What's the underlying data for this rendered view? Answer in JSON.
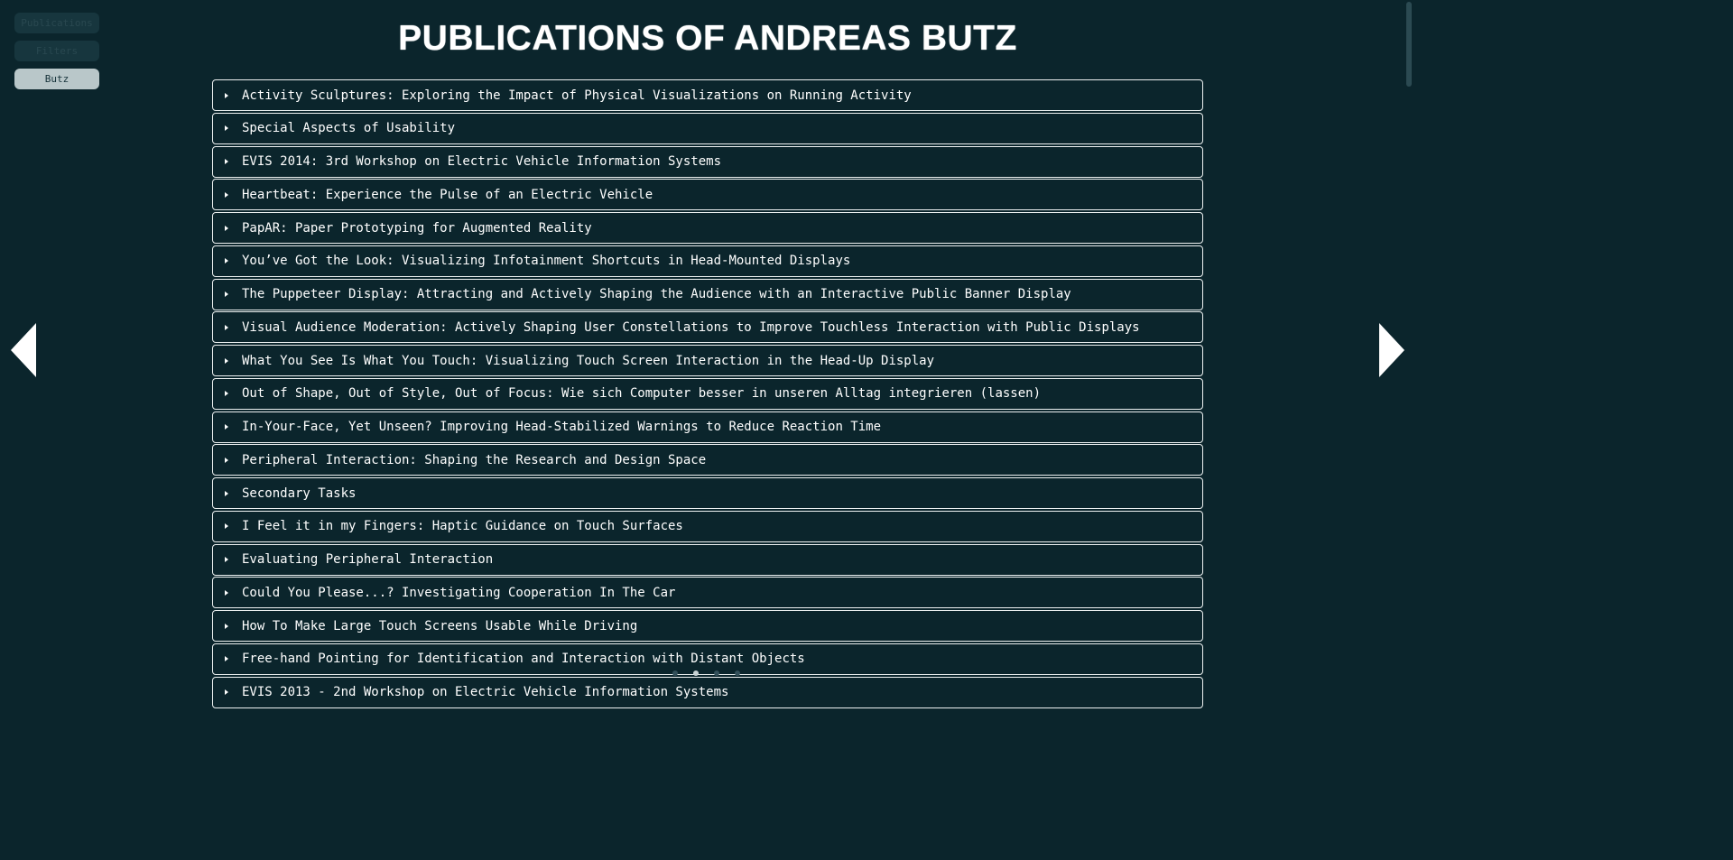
{
  "nav": {
    "buttons": [
      {
        "label": "Publications",
        "state": "muted"
      },
      {
        "label": "Filters",
        "state": "muted"
      },
      {
        "label": "Butz",
        "state": "active"
      }
    ]
  },
  "page": {
    "title": "Publications of Andreas Butz"
  },
  "publications": [
    {
      "title": "Activity Sculptures: Exploring the Impact of Physical Visualizations on Running Activity"
    },
    {
      "title": "Special Aspects of Usability"
    },
    {
      "title": "EVIS 2014: 3rd Workshop on Electric Vehicle Information Systems"
    },
    {
      "title": "Heartbeat: Experience the Pulse of an Electric Vehicle"
    },
    {
      "title": "PapAR: Paper Prototyping for Augmented Reality"
    },
    {
      "title": "You’ve Got the Look: Visualizing Infotainment Shortcuts in Head-Mounted Displays"
    },
    {
      "title": "The Puppeteer Display: Attracting and Actively Shaping the Audience with an Interactive Public Banner Display"
    },
    {
      "title": "Visual Audience Moderation: Actively Shaping User Constellations to Improve Touchless Interaction with Public Displays"
    },
    {
      "title": "What You See Is What You Touch: Visualizing Touch Screen Interaction in the Head-Up Display"
    },
    {
      "title": "Out of Shape, Out of Style, Out of Focus: Wie sich Computer besser in unseren Alltag integrieren (lassen)"
    },
    {
      "title": "In-Your-Face, Yet Unseen? Improving Head-Stabilized Warnings to Reduce Reaction Time"
    },
    {
      "title": "Peripheral Interaction: Shaping the Research and Design Space"
    },
    {
      "title": "Secondary Tasks"
    },
    {
      "title": "I Feel it in my Fingers: Haptic Guidance on Touch Surfaces"
    },
    {
      "title": "Evaluating Peripheral Interaction"
    },
    {
      "title": "Could You Please...? Investigating Cooperation In The Car"
    },
    {
      "title": "How To Make Large Touch Screens Usable While Driving"
    },
    {
      "title": "Free-hand Pointing for Identification and Interaction with Distant Objects"
    },
    {
      "title": "EVIS 2013 - 2nd Workshop on Electric Vehicle Information Systems"
    }
  ],
  "pager": {
    "page_count": 4,
    "current_page": 2
  },
  "icons": {
    "prev": "triangle-left-icon",
    "next": "triangle-right-icon",
    "expand": "caret-right-icon"
  },
  "colors": {
    "background": "#0b252c",
    "text": "#ffffff",
    "active_button": "#b9c7c9",
    "muted_button": "#17363e"
  }
}
